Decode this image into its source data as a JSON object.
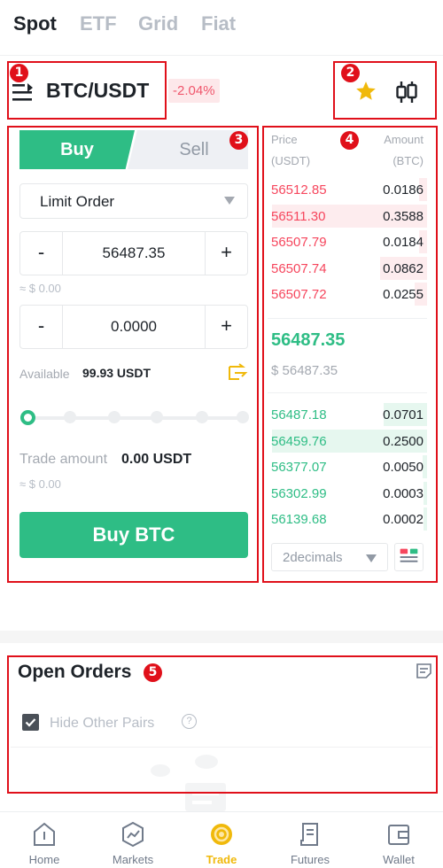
{
  "top_tabs": [
    {
      "label": "Spot",
      "active": true
    },
    {
      "label": "ETF",
      "active": false
    },
    {
      "label": "Grid",
      "active": false
    },
    {
      "label": "Fiat",
      "active": false
    }
  ],
  "header": {
    "pair": "BTC/USDT",
    "change": "-2.04%",
    "icons": [
      "menu-icon",
      "star-icon",
      "candlestick-icon"
    ]
  },
  "annotations": [
    "1",
    "2",
    "3",
    "4",
    "5"
  ],
  "trade_panel": {
    "buy_label": "Buy",
    "sell_label": "Sell",
    "order_type": "Limit Order",
    "price_value": "56487.35",
    "price_fiat": "≈ $ 0.00",
    "amount_value": "0.0000",
    "minus": "-",
    "plus": "+",
    "available_label": "Available",
    "available_value": "99.93 USDT",
    "slider_level": 0,
    "trade_amount_label": "Trade amount",
    "trade_amount_value": "0.00 USDT",
    "trade_amount_fiat": "≈ $ 0.00",
    "buy_button": "Buy BTC"
  },
  "order_book": {
    "price_header": "Price",
    "price_unit": "(USDT)",
    "amount_header": "Amount",
    "amount_unit": "(BTC)",
    "asks": [
      {
        "price": "56512.85",
        "amount": "0.0186",
        "depth": 0.05
      },
      {
        "price": "56511.30",
        "amount": "0.3588",
        "depth": 1.0
      },
      {
        "price": "56507.79",
        "amount": "0.0184",
        "depth": 0.05
      },
      {
        "price": "56507.74",
        "amount": "0.0862",
        "depth": 0.3
      },
      {
        "price": "56507.72",
        "amount": "0.0255",
        "depth": 0.08
      }
    ],
    "last_price": "56487.35",
    "last_price_fiat": "$ 56487.35",
    "bids": [
      {
        "price": "56487.18",
        "amount": "0.0701",
        "depth": 0.28
      },
      {
        "price": "56459.76",
        "amount": "0.2500",
        "depth": 1.0
      },
      {
        "price": "56377.07",
        "amount": "0.0050",
        "depth": 0.03
      },
      {
        "price": "56302.99",
        "amount": "0.0003",
        "depth": 0.02
      },
      {
        "price": "56139.68",
        "amount": "0.0002",
        "depth": 0.02
      }
    ],
    "decimals": "2decimals",
    "ask_color": "#f6465d",
    "bid_color": "#2ebd85"
  },
  "open_orders": {
    "title": "Open Orders",
    "hide_other_pairs": "Hide Other Pairs",
    "hide_checked": true
  },
  "bottom_nav": [
    {
      "label": "Home",
      "icon": "home-icon",
      "active": false
    },
    {
      "label": "Markets",
      "icon": "markets-icon",
      "active": false
    },
    {
      "label": "Trade",
      "icon": "trade-icon",
      "active": true
    },
    {
      "label": "Futures",
      "icon": "futures-icon",
      "active": false
    },
    {
      "label": "Wallet",
      "icon": "wallet-icon",
      "active": false
    }
  ]
}
